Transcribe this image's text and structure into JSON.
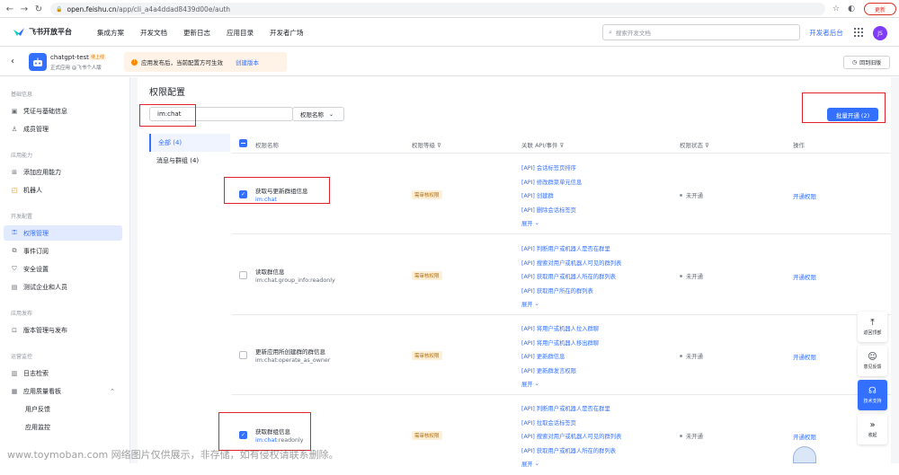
{
  "browser": {
    "url_host": "open.feishu.cn",
    "url_path": "/app/cli_a4a4ddad8439d00e/auth",
    "update_label": "更新"
  },
  "topnav": {
    "brand": "飞书开放平台",
    "links": [
      "集成方案",
      "开发文档",
      "更新日志",
      "应用目录",
      "开发者广场"
    ],
    "search_placeholder": "搜索开发文档",
    "dev_console": "开发者后台",
    "avatar_initials": "JS"
  },
  "appbar": {
    "app_name": "chatgpt-test",
    "app_badge": "待上线",
    "app_sub": "正式应用 @飞书个人版",
    "notice": "应用发布后，当前配置方可生效",
    "notice_link": "创建版本",
    "back_old": "回到旧版"
  },
  "sidebar": {
    "groups": [
      {
        "title": "基础信息",
        "items": [
          {
            "label": "凭证与基础信息",
            "icon": "credential-icon"
          },
          {
            "label": "成员管理",
            "icon": "member-icon"
          }
        ]
      },
      {
        "title": "应用能力",
        "items": [
          {
            "label": "添加应用能力",
            "icon": "grid-add-icon"
          },
          {
            "label": "机器人",
            "icon": "robot-icon"
          }
        ]
      },
      {
        "title": "开发配置",
        "items": [
          {
            "label": "权限管理",
            "icon": "key-icon"
          },
          {
            "label": "事件订阅",
            "icon": "event-icon"
          },
          {
            "label": "安全设置",
            "icon": "shield-icon"
          },
          {
            "label": "测试企业和人员",
            "icon": "test-icon"
          }
        ]
      },
      {
        "title": "应用发布",
        "items": [
          {
            "label": "版本管理与发布",
            "icon": "publish-icon"
          }
        ]
      },
      {
        "title": "运营监控",
        "items": [
          {
            "label": "日志检索",
            "icon": "log-icon"
          },
          {
            "label": "应用质量看板",
            "icon": "chart-icon"
          },
          {
            "label": "用户反馈",
            "icon": ""
          },
          {
            "label": "应用监控",
            "icon": ""
          }
        ]
      }
    ]
  },
  "main": {
    "title": "权限配置",
    "filter_value": "im:chat",
    "filter_select": "权限名称",
    "batch_button": "批量开通 (2)",
    "categories": [
      "全部 (4)",
      "消息与群组 (4)"
    ],
    "headers": {
      "name": "权限名称",
      "level": "权限等级",
      "api": "关联 API/事件",
      "status": "权限状态",
      "op": "操作"
    },
    "rows": [
      {
        "name": "获取与更新群组信息",
        "code_main": "im:chat",
        "code_rest": "",
        "level": "需审核权限",
        "checked": true,
        "apis": [
          "[API] 会话标签页排序",
          "[API] 修改群菜单元信息",
          "[API] 创建群",
          "[API] 删除会话标签页"
        ],
        "expand": "展开",
        "status": "未开通",
        "op": "开通权限"
      },
      {
        "name": "读取群信息",
        "code_main": "im:chat",
        "code_rest": ".group_info:readonly",
        "level": "需审核权限",
        "checked": false,
        "apis": [
          "[API] 判断用户或机器人是否在群里",
          "[API] 搜索对用户或机器人可见的群列表",
          "[API] 获取用户或机器人所在的群列表",
          "[API] 获取用户所在的群列表"
        ],
        "expand": "展开",
        "status": "未开通",
        "op": "开通权限"
      },
      {
        "name": "更新应用所创建群的群信息",
        "code_main": "im:chat",
        "code_rest": ":operate_as_owner",
        "level": "需审核权限",
        "checked": false,
        "apis": [
          "[API] 将用户或机器人拉入群聊",
          "[API] 将用户或机器人移出群聊",
          "[API] 更新群信息",
          "[API] 更新群发言权限"
        ],
        "expand": "展开",
        "status": "未开通",
        "op": "开通权限"
      },
      {
        "name": "获取群组信息",
        "code_main": "im:chat",
        "code_rest": ":readonly",
        "level": "需审核权限",
        "checked": true,
        "apis": [
          "[API] 判断用户或机器人是否在群里",
          "[API] 拉取会话标签页",
          "[API] 搜索对用户或机器人可见的群列表",
          "[API] 获取用户或机器人所在的群列表"
        ],
        "expand": "展开",
        "status": "未开通",
        "op": "开通权限"
      }
    ]
  },
  "floatbar": [
    {
      "label": "返回顶部",
      "glyph": "⤒"
    },
    {
      "label": "意见反馈",
      "glyph": "☺"
    },
    {
      "label": "技术支持",
      "glyph": "☊"
    },
    {
      "label": "收起",
      "glyph": "»"
    }
  ],
  "watermark": "www.toymoban.com 网络图片仅供展示，非存储，如有侵权请联系删除。"
}
